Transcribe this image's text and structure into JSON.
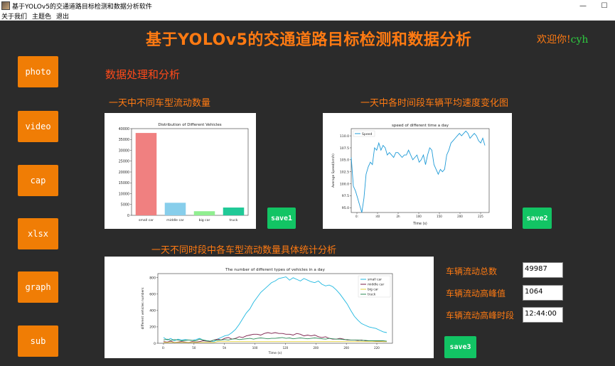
{
  "window": {
    "title": "基于YOLOv5的交通道路目标检测和数据分析软件",
    "minimize": "—",
    "maximize": "☐"
  },
  "menu": [
    "关于我们",
    "主题色",
    "退出"
  ],
  "header": {
    "title": "基于YOLOv5的交通道路目标检测和数据分析",
    "welcome_prefix": "欢迎你!",
    "username": "cyh"
  },
  "sidebar": [
    "photo",
    "video",
    "cap",
    "xlsx",
    "graph",
    "sub"
  ],
  "section_title": "数据处理和分析",
  "charts": {
    "c1_title": "一天中不同车型流动数量",
    "c2_title": "一天中各时间段车辆平均速度变化图",
    "c3_title": "一天不同时段中各车型流动数量具体统计分析"
  },
  "buttons": {
    "save1": "save1",
    "save2": "save2",
    "save3": "save3"
  },
  "stats": {
    "total_label": "车辆流动总数",
    "total_value": "49987",
    "peak_label": "车辆流动高峰值",
    "peak_value": "1064",
    "peak_time_label": "车辆流动高峰时段",
    "peak_time_value": "12:44:00"
  },
  "chart_data": [
    {
      "type": "bar",
      "title": "Distribution of Different Vehicles",
      "categories": [
        "small car",
        "middle car",
        "big car",
        "truck"
      ],
      "values": [
        38000,
        5800,
        1900,
        3600
      ],
      "colors": [
        "#f08080",
        "#87ceeb",
        "#90ee90",
        "#20c997"
      ],
      "ylim": [
        0,
        40000
      ],
      "yticks": [
        0,
        5000,
        10000,
        15000,
        20000,
        25000,
        30000,
        35000,
        40000
      ]
    },
    {
      "type": "line",
      "title": "speed of different time a day",
      "xlabel": "Time (s)",
      "ylabel": "Average Speed(km/h)",
      "series": [
        {
          "name": "Speed",
          "color": "#1f9bd7",
          "x": [
            0,
            4,
            8,
            12,
            16,
            20,
            24,
            28,
            32,
            36,
            40,
            44,
            48,
            52,
            56,
            60,
            64,
            68,
            72,
            76,
            80,
            84,
            88,
            92,
            96,
            100,
            104,
            108,
            112,
            116,
            120,
            124,
            128,
            132,
            136,
            140,
            144,
            148,
            152,
            156,
            160,
            164,
            168,
            172,
            176,
            180,
            184,
            188,
            192,
            196,
            200,
            204,
            208,
            212,
            216,
            220,
            224,
            228,
            232,
            236,
            240,
            244,
            248,
            252
          ],
          "values": [
            105.5,
            99.5,
            98.5,
            97,
            95.5,
            94,
            97,
            102,
            103.5,
            104.5,
            104,
            107.5,
            107,
            108.5,
            107,
            108,
            107.5,
            106,
            106.5,
            106,
            105.5,
            106.5,
            106.5,
            106,
            105.5,
            106,
            106,
            107,
            106,
            105,
            105.5,
            106,
            104.5,
            105,
            106,
            104,
            106,
            107.5,
            107,
            104,
            103,
            102,
            103,
            102.5,
            103,
            106,
            107,
            108.5,
            109,
            109.5,
            110,
            110.5,
            110,
            110.5,
            111,
            110.5,
            109.5,
            110,
            110.5,
            110,
            109,
            108.5,
            109.5,
            108
          ]
        }
      ],
      "ylim": [
        94,
        111.5
      ],
      "yticks": [
        95.0,
        97.5,
        100.0,
        102.5,
        105.0,
        107.5,
        110.0
      ],
      "xlim": [
        0,
        260
      ],
      "xticks": [
        "0:",
        ":40",
        "2h",
        "100",
        "150",
        "200",
        "225"
      ]
    },
    {
      "type": "line",
      "title": "The number of different types of vehicles in a day",
      "xlabel": "Time (s)",
      "ylabel": "different vehicles numbers",
      "ylim": [
        0,
        850
      ],
      "yticks": [
        0,
        200,
        400,
        600,
        800
      ],
      "series": [
        {
          "name": "small car",
          "color": "#1fb8e0",
          "values": [
            70,
            40,
            60,
            30,
            50,
            40,
            45,
            40,
            35,
            45,
            60,
            40,
            30,
            25,
            20,
            50,
            70,
            90,
            100,
            130,
            170,
            230,
            300,
            370,
            420,
            500,
            560,
            620,
            660,
            700,
            740,
            760,
            790,
            800,
            810,
            770,
            800,
            780,
            760,
            790,
            770,
            750,
            740,
            760,
            720,
            700,
            710,
            690,
            650,
            600,
            540,
            480,
            400,
            330,
            280,
            240,
            220,
            200,
            190,
            180,
            160,
            140,
            130
          ]
        },
        {
          "name": "middle car",
          "color": "#7b1f4a",
          "values": [
            20,
            15,
            25,
            10,
            15,
            20,
            15,
            10,
            20,
            15,
            20,
            30,
            25,
            20,
            40,
            50,
            40,
            60,
            70,
            50,
            60,
            80,
            70,
            90,
            100,
            110,
            110,
            100,
            120,
            130,
            120,
            130,
            120,
            120,
            110,
            110,
            100,
            120,
            110,
            90,
            100,
            90,
            100,
            80,
            70,
            80,
            60,
            50,
            50,
            60,
            50,
            40,
            40,
            40,
            35,
            40,
            30,
            30,
            30,
            25,
            25,
            20,
            20
          ]
        },
        {
          "name": "big car",
          "color": "#e6d23a",
          "values": [
            10,
            10,
            10,
            10,
            10,
            10,
            10,
            10,
            10,
            10,
            10,
            10,
            10,
            10,
            10,
            20,
            20,
            20,
            20,
            20,
            20,
            20,
            20,
            20,
            20,
            20,
            20,
            20,
            20,
            20,
            20,
            20,
            20,
            20,
            20,
            20,
            20,
            20,
            20,
            20,
            20,
            20,
            20,
            20,
            20,
            20,
            20,
            20,
            20,
            20,
            20,
            20,
            20,
            20,
            20,
            20,
            20,
            20,
            20,
            20,
            20,
            20,
            20
          ]
        },
        {
          "name": "truck",
          "color": "#2e8b57",
          "values": [
            40,
            50,
            35,
            45,
            40,
            30,
            35,
            40,
            35,
            30,
            50,
            40,
            30,
            25,
            40,
            35,
            40,
            45,
            40,
            50,
            55,
            45,
            50,
            55,
            60,
            50,
            60,
            65,
            60,
            55,
            60,
            60,
            65,
            70,
            60,
            65,
            55,
            60,
            65,
            60,
            55,
            60,
            65,
            60,
            55,
            50,
            60,
            55,
            50,
            50,
            45,
            45,
            40,
            40,
            40,
            35,
            35,
            30,
            30,
            30,
            30,
            30,
            25
          ]
        }
      ],
      "xticks": [
        "0:",
        "50",
        "5h",
        "100",
        "120",
        "200",
        "200",
        "220"
      ]
    }
  ]
}
